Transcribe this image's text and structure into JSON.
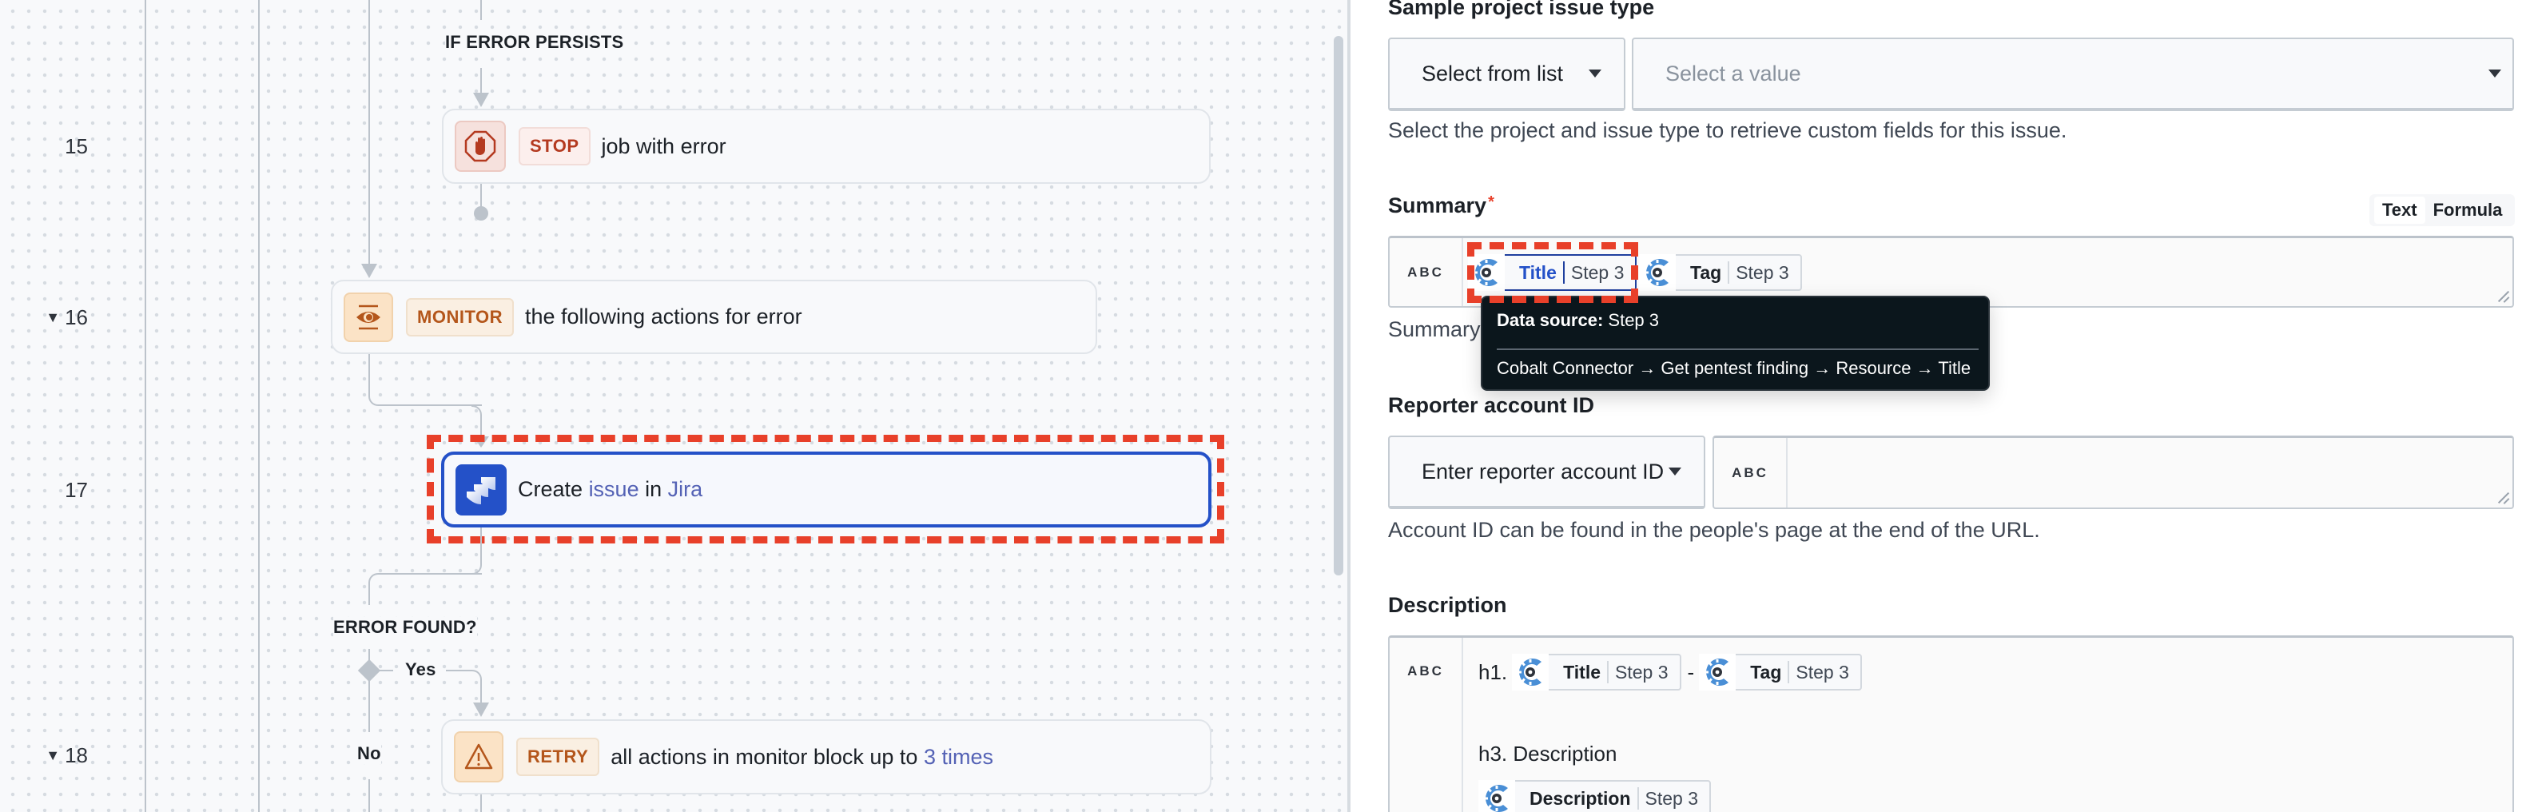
{
  "flow": {
    "line_numbers": [
      {
        "num": "15",
        "collapsible": false
      },
      {
        "num": "16",
        "collapsible": true
      },
      {
        "num": "17",
        "collapsible": false
      },
      {
        "num": "18",
        "collapsible": true
      }
    ],
    "labels": {
      "if_error_persists": "IF ERROR PERSISTS",
      "error_found": "ERROR FOUND?",
      "yes": "Yes",
      "no": "No"
    },
    "nodes": {
      "stop": {
        "icon": "stop-hand-icon",
        "badge": "STOP",
        "text": "job with error"
      },
      "monitor": {
        "icon": "eye-icon",
        "badge": "MONITOR",
        "text": "the following actions for error"
      },
      "jira": {
        "icon": "jira-icon",
        "text_before": "Create",
        "link1": "issue",
        "text_mid": "in",
        "link2": "Jira",
        "selected": true
      },
      "retry": {
        "icon": "warning-icon",
        "badge": "RETRY",
        "text": "all actions in monitor block up to",
        "link": "3 times"
      }
    }
  },
  "panel": {
    "sample_issue_type": {
      "label": "Sample project issue type",
      "mode_select": "Select from list",
      "value_select_placeholder": "Select a value",
      "help": "Select the project and issue type to retrieve custom fields for this issue."
    },
    "summary": {
      "label": "Summary",
      "required_mark": "*",
      "mode_toggle": {
        "options": [
          "Text",
          "Formula"
        ],
        "selected": "Text"
      },
      "type_tag": "ABC",
      "pills": [
        {
          "name": "Title",
          "step": "Step 3",
          "active": true
        },
        {
          "name": "Tag",
          "step": "Step 3",
          "active": false
        }
      ],
      "help": "Summary"
    },
    "tooltip": {
      "title_label": "Data source:",
      "title_value": "Step 3",
      "path": "Cobalt Connector → Get pentest finding → Resource → Title"
    },
    "reporter": {
      "label": "Reporter account ID",
      "mode_select": "Enter reporter account ID",
      "type_tag": "ABC",
      "value": "",
      "help": "Account ID can be found in the people's page at the end of the URL."
    },
    "description": {
      "label": "Description",
      "type_tag": "ABC",
      "h1_prefix": "h1.",
      "h1_pills": [
        {
          "name": "Title",
          "step": "Step 3"
        },
        {
          "name": "Tag",
          "step": "Step 3"
        }
      ],
      "h1_separator": "-",
      "h3_text": "h3. Description",
      "body_pills": [
        {
          "name": "Description",
          "step": "Step 3"
        }
      ]
    }
  },
  "colors": {
    "accent_blue": "#2451c8",
    "highlight_red": "#e8402a",
    "stop_red": "#b43a20",
    "warn_orange": "#b4561b",
    "link_purple": "#5462b5",
    "cobalt_blue": "#4a8fd6"
  }
}
